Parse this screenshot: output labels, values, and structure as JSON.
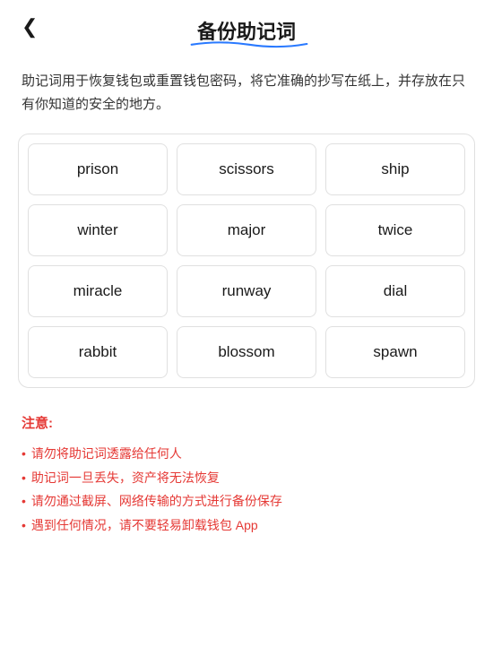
{
  "header": {
    "back_label": "‹",
    "title": "备份助记词"
  },
  "description": "助记词用于恢复钱包或重置钱包密码，将它准确的抄写在纸上，并存放在只有你知道的安全的地方。",
  "mnemonic_grid": {
    "words": [
      "prison",
      "scissors",
      "ship",
      "winter",
      "major",
      "twice",
      "miracle",
      "runway",
      "dial",
      "rabbit",
      "blossom",
      "spawn"
    ]
  },
  "notice": {
    "title": "注意:",
    "items": [
      "请勿将助记词透露给任何人",
      "助记词一旦丢失，资产将无法恢复",
      "请勿通过截屏、网络传输的方式进行备份保存",
      "遇到任何情况，请不要轻易卸载钱包 App"
    ]
  }
}
